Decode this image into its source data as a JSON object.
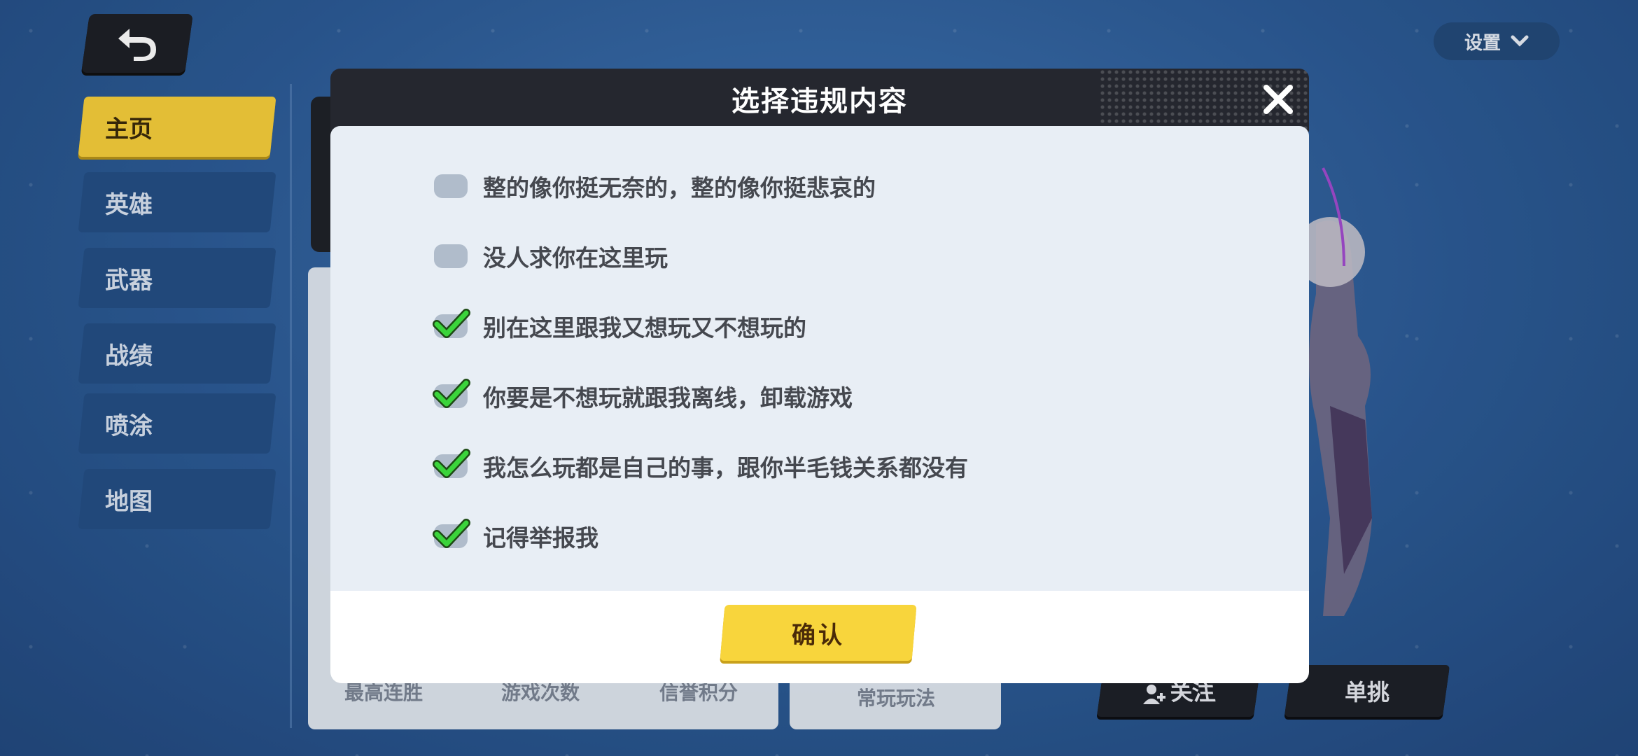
{
  "colors": {
    "accent_yellow": "#f7cf3b",
    "dialog_header": "#25272f",
    "dialog_body": "#e8eef5",
    "check_green": "#3bd43b",
    "background_blue": "#2f5f99"
  },
  "header": {
    "back_icon": "back-arrow-icon",
    "settings_label": "设置"
  },
  "sidebar": {
    "items": [
      {
        "label": "主页",
        "active": true
      },
      {
        "label": "英雄",
        "active": false
      },
      {
        "label": "武器",
        "active": false
      },
      {
        "label": "战绩",
        "active": false
      },
      {
        "label": "喷涂",
        "active": false
      },
      {
        "label": "地图",
        "active": false
      }
    ]
  },
  "background_panel": {
    "stats_labels": [
      "最高连胜",
      "游戏次数",
      "信誉积分"
    ],
    "mode_label": "常玩玩法"
  },
  "actions": {
    "follow_label": "关注",
    "duel_label": "单挑"
  },
  "dialog": {
    "title": "选择违规内容",
    "close_icon": "close-icon",
    "options": [
      {
        "label": "整的像你挺无奈的，整的像你挺悲哀的",
        "checked": false
      },
      {
        "label": "没人求你在这里玩",
        "checked": false
      },
      {
        "label": "别在这里跟我又想玩又不想玩的",
        "checked": true
      },
      {
        "label": "你要是不想玩就跟我离线，卸载游戏",
        "checked": true
      },
      {
        "label": "我怎么玩都是自己的事，跟你半毛钱关系都没有",
        "checked": true
      },
      {
        "label": "记得举报我",
        "checked": true
      }
    ],
    "confirm_label": "确认"
  }
}
